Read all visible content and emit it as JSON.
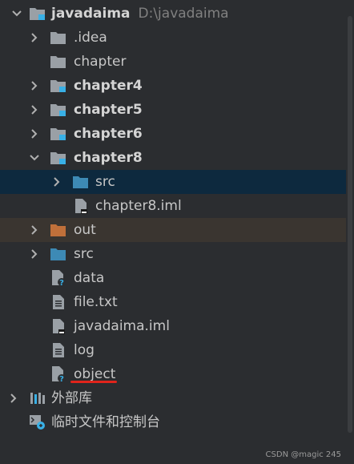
{
  "root": {
    "name": "javadaima",
    "path": "D:\\javadaima"
  },
  "items": [
    {
      "label": ".idea"
    },
    {
      "label": "chapter"
    },
    {
      "label": "chapter4"
    },
    {
      "label": "chapter5"
    },
    {
      "label": "chapter6"
    },
    {
      "label": "chapter8"
    },
    {
      "label": "src"
    },
    {
      "label": "chapter8.iml"
    },
    {
      "label": "out"
    },
    {
      "label": "src"
    },
    {
      "label": "data"
    },
    {
      "label": "file.txt"
    },
    {
      "label": "javadaima.iml"
    },
    {
      "label": "log"
    },
    {
      "label": "object"
    },
    {
      "label": "外部库"
    },
    {
      "label": "临时文件和控制台"
    }
  ],
  "watermark": "CSDN @magic 245",
  "colors": {
    "background": "#2b2d30",
    "selected": "#0d293e",
    "excluded_folder": "#c0703a",
    "source_folder": "#3d8ab5",
    "module_badge": "#39b0e6",
    "annotation_underline": "#e0241b"
  }
}
